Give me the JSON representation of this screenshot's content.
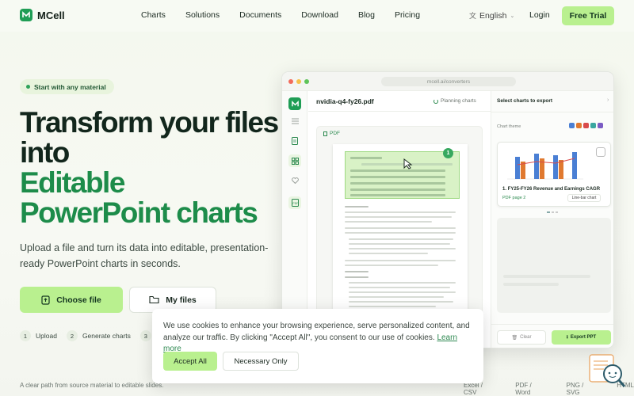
{
  "brand": {
    "name": "MCell"
  },
  "nav": {
    "links": [
      "Charts",
      "Solutions",
      "Documents",
      "Download",
      "Blog",
      "Pricing"
    ],
    "language": "English",
    "login": "Login",
    "cta": "Free Trial"
  },
  "hero": {
    "badge": "Start with any material",
    "title_line1": "Transform your files",
    "title_line2": "into",
    "title_line3": "Editable",
    "title_line4": "PowerPoint charts",
    "subtitle": "Upload a file and turn its data into editable, presentation-ready PowerPoint charts in seconds.",
    "choose_file": "Choose file",
    "my_files": "My files",
    "steps": [
      {
        "num": "1",
        "label": "Upload"
      },
      {
        "num": "2",
        "label": "Generate charts"
      },
      {
        "num": "3",
        "label": ""
      }
    ]
  },
  "mockup": {
    "url": "mcell.ai/converters",
    "file_name": "nvidia-q4-fy26.pdf",
    "status": "Planning charts",
    "pdf_label": "PDF",
    "right_title": "Select charts to export",
    "chart_theme_label": "Chart theme",
    "theme_colors": [
      "#4a7fd4",
      "#e0792f",
      "#d94b4b",
      "#3aa6a0",
      "#7b5cc4"
    ],
    "card_title": "1. FY25-FY26 Revenue and Earnings CAGR",
    "card_page": "PDF page 2",
    "card_dropdown": "Line-bar chart",
    "clear": "Clear",
    "export": "Export PPT"
  },
  "cookie": {
    "text": "We use cookies to enhance your browsing experience, serve personalized content, and analyze our traffic. By clicking \"Accept All\", you consent to our use of cookies.",
    "learn_more": "Learn more",
    "accept": "Accept All",
    "necessary": "Necessary Only"
  },
  "footer": {
    "left": "A clear path from source material to editable slides.",
    "formats": [
      "Excel / CSV",
      "PDF / Word",
      "PNG / SVG",
      "HTML"
    ]
  }
}
